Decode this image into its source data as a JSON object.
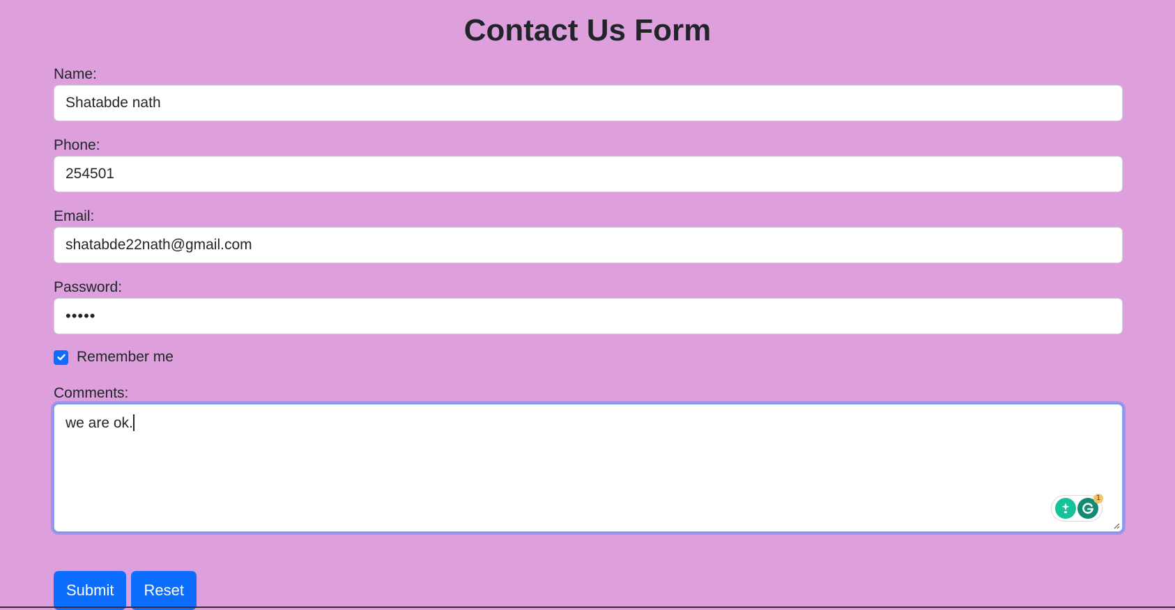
{
  "page": {
    "title": "Contact Us Form",
    "background": "#dda0dd"
  },
  "form": {
    "name": {
      "label": "Name:",
      "value": "Shatabde nath"
    },
    "phone": {
      "label": "Phone:",
      "value": "254501"
    },
    "email": {
      "label": "Email:",
      "value": "shatabde22nath@gmail.com"
    },
    "password": {
      "label": "Password:",
      "value": "•••••"
    },
    "remember": {
      "label": "Remember me",
      "checked": true
    },
    "comments": {
      "label": "Comments:",
      "value": "we are ok."
    },
    "grammarly": {
      "badge_count": "1"
    }
  },
  "buttons": {
    "submit_label": "Submit",
    "reset_label": "Reset",
    "color": "#0d6efd"
  }
}
